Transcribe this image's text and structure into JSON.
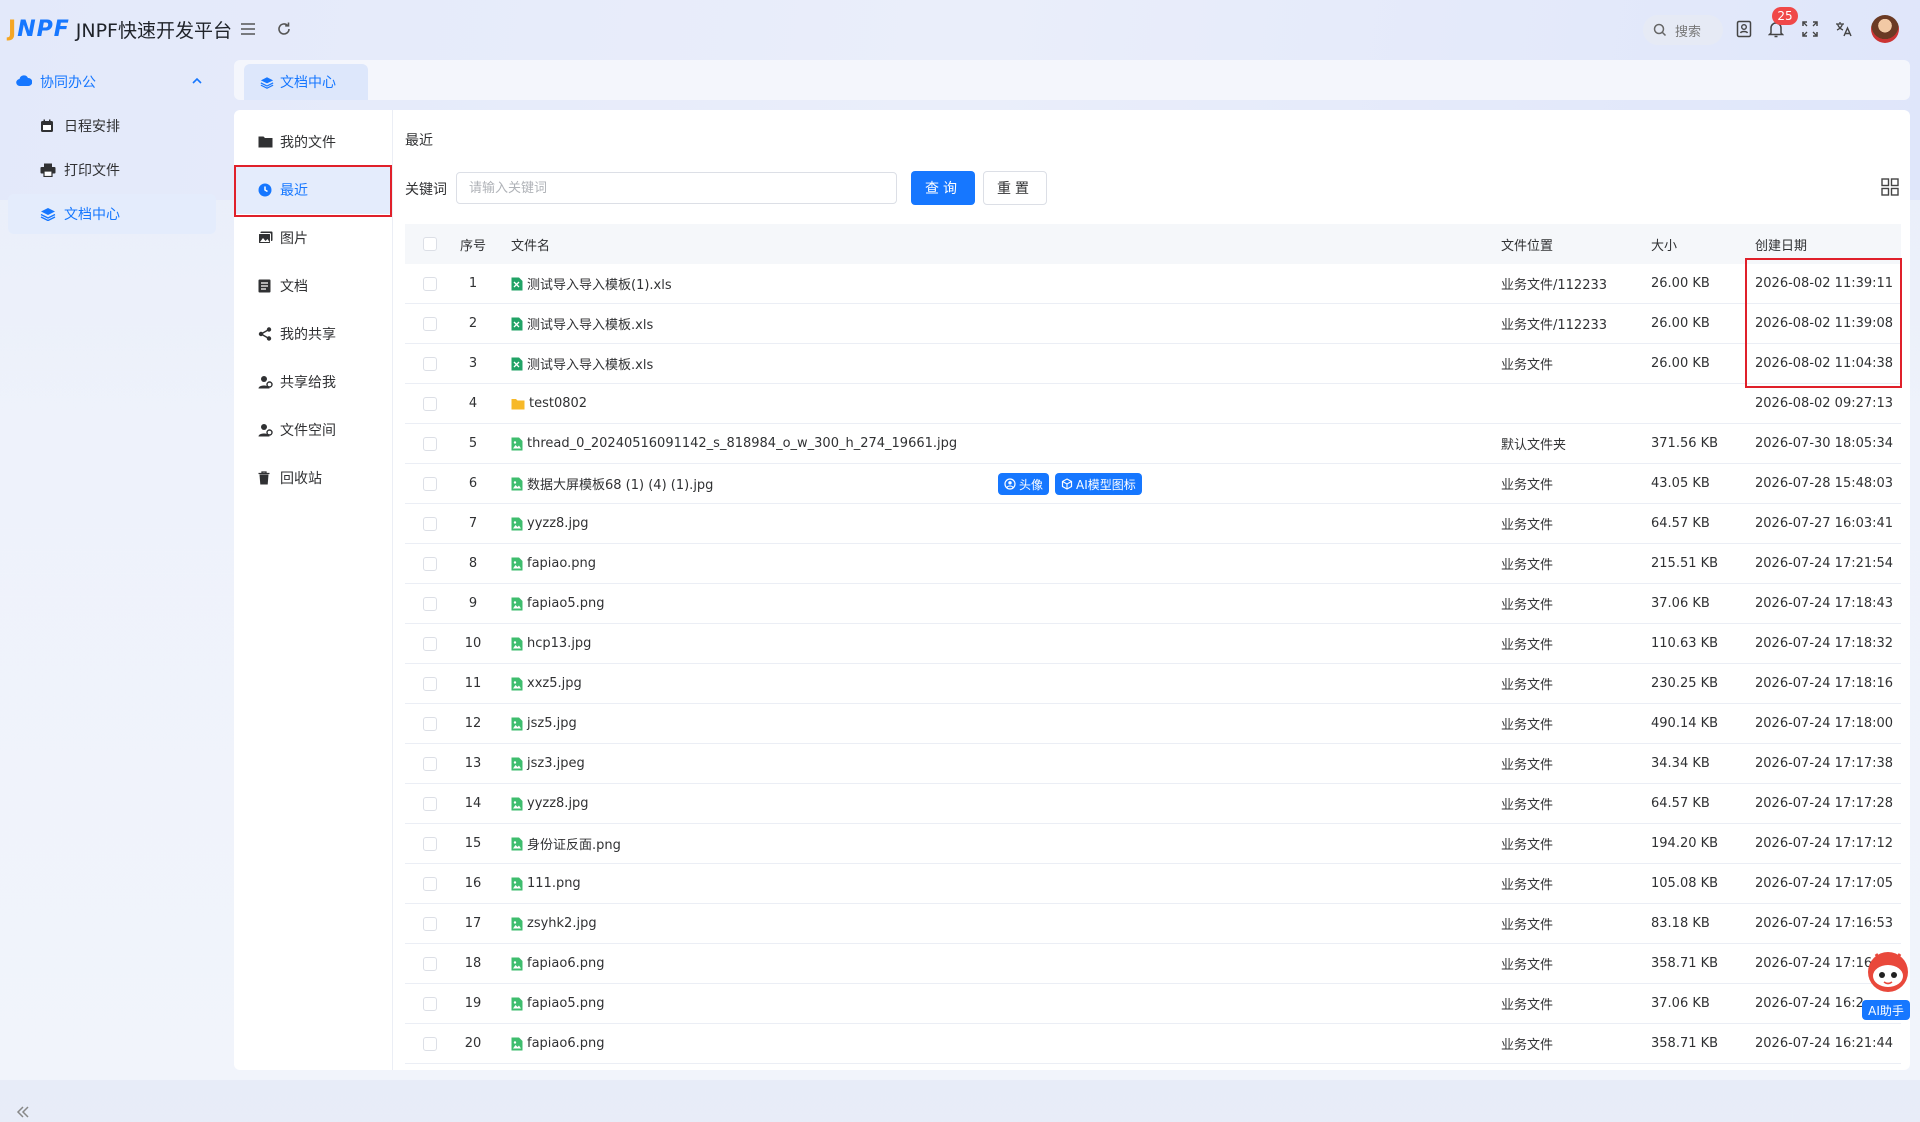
{
  "header": {
    "logo_mark_j": "J",
    "logo_mark_rest": "NPF",
    "app_title": "JNPF快速开发平台",
    "search_label": "搜索",
    "notification_count": "25"
  },
  "sidebar": {
    "group_label": "协同办公",
    "items": [
      {
        "label": "日程安排",
        "icon": "calendar-icon"
      },
      {
        "label": "打印文件",
        "icon": "printer-icon"
      },
      {
        "label": "文档中心",
        "icon": "layers-icon",
        "active": true
      }
    ]
  },
  "tabs": [
    {
      "label": "文档中心"
    }
  ],
  "categories": [
    {
      "label": "我的文件",
      "icon": "folder-icon"
    },
    {
      "label": "最近",
      "icon": "clock-icon",
      "active": true
    },
    {
      "label": "图片",
      "icon": "image-icon"
    },
    {
      "label": "文档",
      "icon": "document-icon"
    },
    {
      "label": "我的共享",
      "icon": "share-icon"
    },
    {
      "label": "共享给我",
      "icon": "users-icon"
    },
    {
      "label": "文件空间",
      "icon": "user-space-icon"
    },
    {
      "label": "回收站",
      "icon": "trash-icon"
    }
  ],
  "main": {
    "title": "最近",
    "keyword_label": "关键词",
    "keyword_placeholder": "请输入关键词",
    "query_button": "查询",
    "reset_button": "重置"
  },
  "table": {
    "columns": {
      "index": "序号",
      "name": "文件名",
      "location": "文件位置",
      "size": "大小",
      "created": "创建日期"
    },
    "rows": [
      {
        "idx": "1",
        "name": "测试导入导入模板(1).xls",
        "type": "xls",
        "location": "业务文件/112233",
        "size": "26.00 KB",
        "date": "2026-08-02 11:39:11"
      },
      {
        "idx": "2",
        "name": "测试导入导入模板.xls",
        "type": "xls",
        "location": "业务文件/112233",
        "size": "26.00 KB",
        "date": "2026-08-02 11:39:08"
      },
      {
        "idx": "3",
        "name": "测试导入导入模板.xls",
        "type": "xls",
        "location": "业务文件",
        "size": "26.00 KB",
        "date": "2026-08-02 11:04:38"
      },
      {
        "idx": "4",
        "name": "test0802",
        "type": "folder",
        "location": "",
        "size": "",
        "date": "2026-08-02 09:27:13"
      },
      {
        "idx": "5",
        "name": "thread_0_20240516091142_s_818984_o_w_300_h_274_19661.jpg",
        "type": "img",
        "location": "默认文件夹",
        "size": "371.56 KB",
        "date": "2026-07-30 18:05:34"
      },
      {
        "idx": "6",
        "name": "数据大屏模板68 (1) (4) (1).jpg",
        "type": "img",
        "location": "业务文件",
        "size": "43.05 KB",
        "date": "2026-07-28 15:48:03",
        "tags": [
          "头像",
          "AI模型图标"
        ]
      },
      {
        "idx": "7",
        "name": "yyzz8.jpg",
        "type": "img",
        "location": "业务文件",
        "size": "64.57 KB",
        "date": "2026-07-27 16:03:41"
      },
      {
        "idx": "8",
        "name": "fapiao.png",
        "type": "img",
        "location": "业务文件",
        "size": "215.51 KB",
        "date": "2026-07-24 17:21:54"
      },
      {
        "idx": "9",
        "name": "fapiao5.png",
        "type": "img",
        "location": "业务文件",
        "size": "37.06 KB",
        "date": "2026-07-24 17:18:43"
      },
      {
        "idx": "10",
        "name": "hcp13.jpg",
        "type": "img",
        "location": "业务文件",
        "size": "110.63 KB",
        "date": "2026-07-24 17:18:32"
      },
      {
        "idx": "11",
        "name": "xxz5.jpg",
        "type": "img",
        "location": "业务文件",
        "size": "230.25 KB",
        "date": "2026-07-24 17:18:16"
      },
      {
        "idx": "12",
        "name": "jsz5.jpg",
        "type": "img",
        "location": "业务文件",
        "size": "490.14 KB",
        "date": "2026-07-24 17:18:00"
      },
      {
        "idx": "13",
        "name": "jsz3.jpeg",
        "type": "img",
        "location": "业务文件",
        "size": "34.34 KB",
        "date": "2026-07-24 17:17:38"
      },
      {
        "idx": "14",
        "name": "yyzz8.jpg",
        "type": "img",
        "location": "业务文件",
        "size": "64.57 KB",
        "date": "2026-07-24 17:17:28"
      },
      {
        "idx": "15",
        "name": "身份证反面.png",
        "type": "img",
        "location": "业务文件",
        "size": "194.20 KB",
        "date": "2026-07-24 17:17:12"
      },
      {
        "idx": "16",
        "name": "111.png",
        "type": "img",
        "location": "业务文件",
        "size": "105.08 KB",
        "date": "2026-07-24 17:17:05"
      },
      {
        "idx": "17",
        "name": "zsyhk2.jpg",
        "type": "img",
        "location": "业务文件",
        "size": "83.18 KB",
        "date": "2026-07-24 17:16:53"
      },
      {
        "idx": "18",
        "name": "fapiao6.png",
        "type": "img",
        "location": "业务文件",
        "size": "358.71 KB",
        "date": "2026-07-24 17:16:"
      },
      {
        "idx": "19",
        "name": "fapiao5.png",
        "type": "img",
        "location": "业务文件",
        "size": "37.06 KB",
        "date": "2026-07-24 16:2"
      },
      {
        "idx": "20",
        "name": "fapiao6.png",
        "type": "img",
        "location": "业务文件",
        "size": "358.71 KB",
        "date": "2026-07-24 16:21:44"
      }
    ]
  },
  "assistant": {
    "label": "AI助手"
  },
  "colors": {
    "primary": "#1677ff",
    "highlight_box": "#e0202a",
    "xls_icon": "#21a366",
    "img_icon": "#3ebd6e",
    "folder_icon": "#f7b928"
  }
}
